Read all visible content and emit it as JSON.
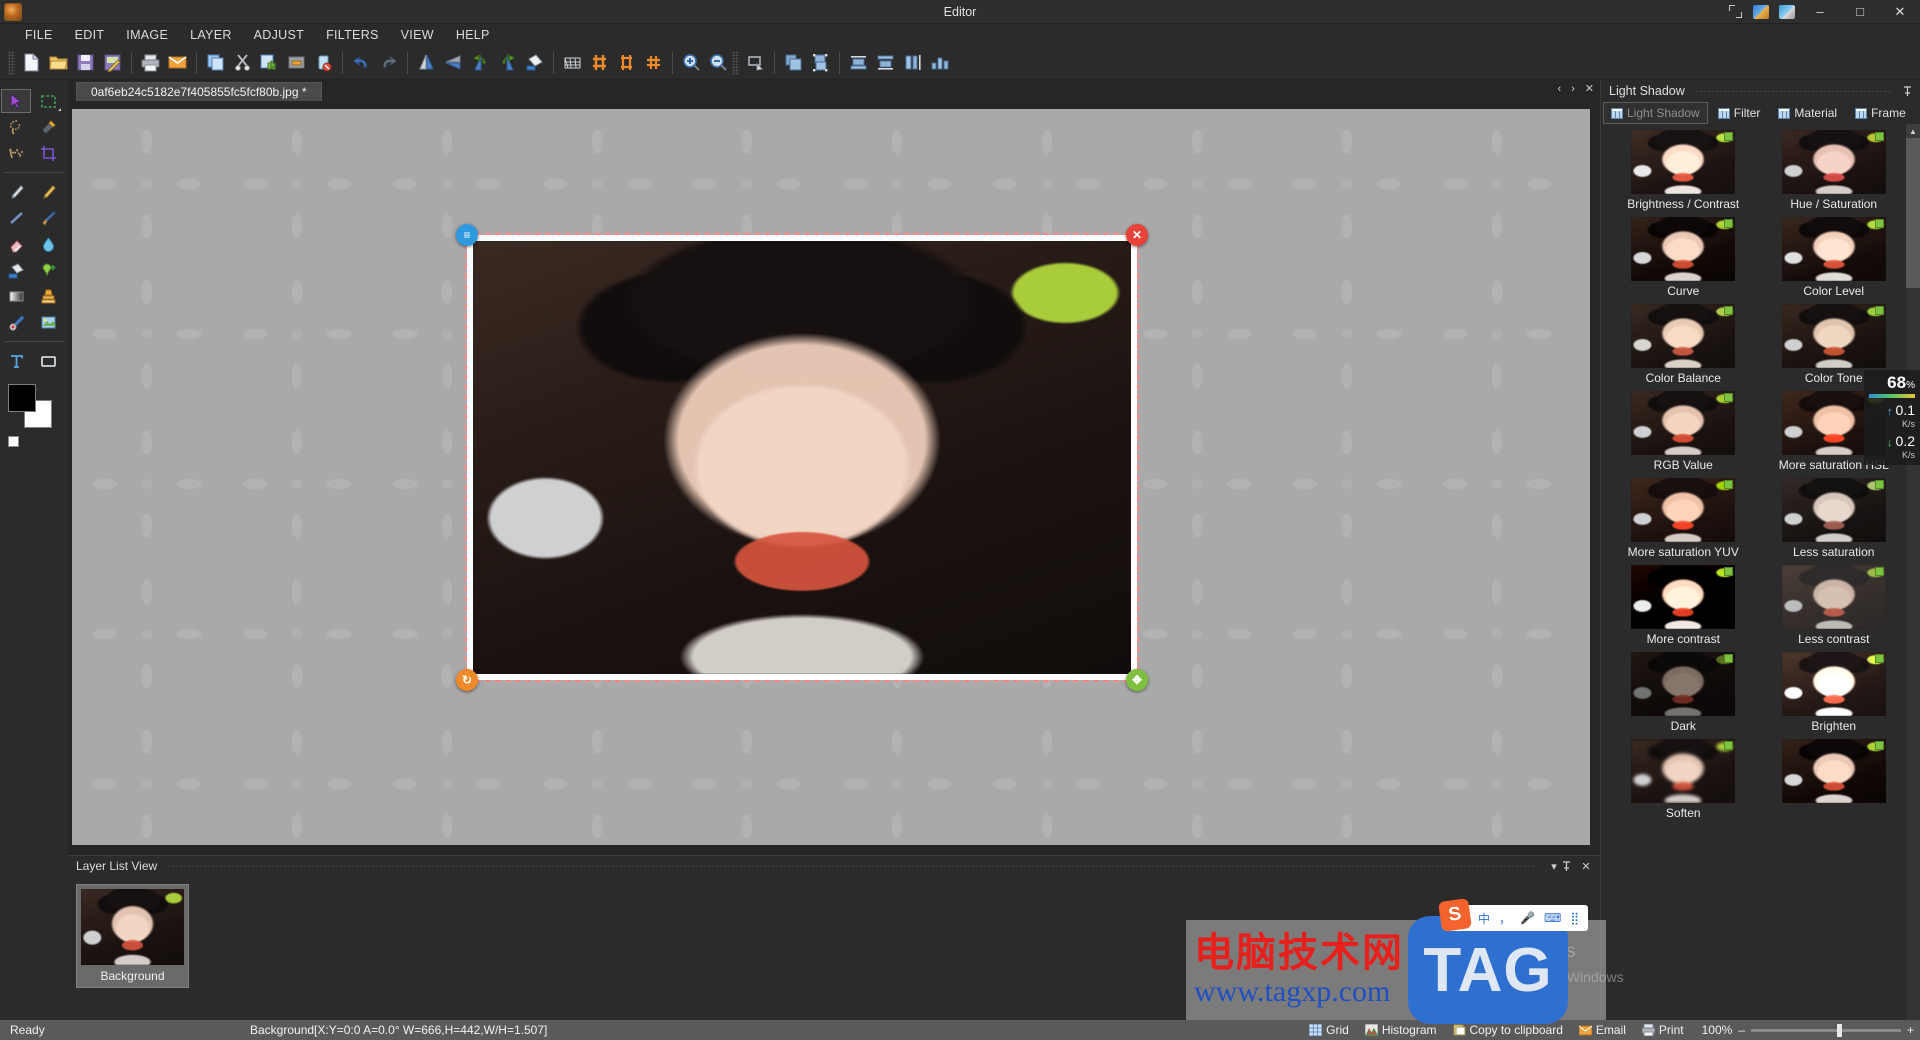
{
  "window": {
    "title": "Editor",
    "app_icon": "app-icon",
    "controls": {
      "minimize": "–",
      "maximize": "□",
      "close": "✕"
    },
    "extra_icons": [
      "fullscreen-icon",
      "image-a-icon",
      "image-b-icon"
    ]
  },
  "menubar": {
    "items": [
      "FILE",
      "EDIT",
      "IMAGE",
      "LAYER",
      "ADJUST",
      "FILTERS",
      "VIEW",
      "HELP"
    ]
  },
  "toolbar": {
    "groups": [
      [
        "new-document",
        "open-folder",
        "save-floppy",
        "save-as"
      ],
      [
        "print",
        "email"
      ],
      [
        "copy",
        "cut",
        "paste",
        "delete-selection",
        "clear-trash"
      ],
      [
        "undo",
        "redo"
      ],
      [
        "flip-horizontal",
        "flip-vertical",
        "rotate-left",
        "rotate-right",
        "fill-bucket"
      ],
      [
        "perspective-grid",
        "warp-mesh",
        "mesh-vertical",
        "mesh-hash"
      ],
      [
        "zoom-in",
        "zoom-out"
      ],
      [
        "select-shape",
        "layer-front",
        "layer-group"
      ],
      [
        "align-top",
        "align-bottom",
        "align-left",
        "align-distribute"
      ]
    ]
  },
  "tools": {
    "items": [
      {
        "name": "pointer-tool",
        "selected": true
      },
      {
        "name": "rect-select-tool",
        "selected": false
      },
      {
        "name": "lasso-tool",
        "selected": false
      },
      {
        "name": "magic-wand-tool",
        "selected": false
      },
      {
        "name": "polygon-lasso-tool",
        "selected": false
      },
      {
        "name": "crop-tool",
        "selected": false
      },
      {
        "name": "pen-tool",
        "selected": false
      },
      {
        "name": "pencil-tool",
        "selected": false
      },
      {
        "name": "line-tool",
        "selected": false
      },
      {
        "name": "brush-tool",
        "selected": false
      },
      {
        "name": "eraser-tool",
        "selected": false
      },
      {
        "name": "blur-drop-tool",
        "selected": false
      },
      {
        "name": "paint-bucket-tool",
        "selected": false
      },
      {
        "name": "color-picker-add-tool",
        "selected": false
      },
      {
        "name": "gradient-tool",
        "selected": false
      },
      {
        "name": "stamp-tool",
        "selected": false
      },
      {
        "name": "red-eye-tool",
        "selected": false
      },
      {
        "name": "image-effect-tool",
        "selected": false
      },
      {
        "name": "text-tool",
        "selected": false
      },
      {
        "name": "shape-rect-tool",
        "selected": false
      }
    ],
    "foreground_color": "#000000",
    "background_color": "#ffffff"
  },
  "document": {
    "tab_label": "0af6eb24c5182e7f405855fc5fcf80b.jpg *",
    "tab_nav": [
      "‹",
      "›",
      "✕"
    ],
    "handles": [
      {
        "name": "menu-handle",
        "glyph": "≡",
        "color": "#2f9ae0"
      },
      {
        "name": "close-handle",
        "glyph": "✕",
        "color": "#e8433a"
      },
      {
        "name": "rotate-handle",
        "glyph": "↻",
        "color": "#ef8a2b"
      },
      {
        "name": "scale-handle",
        "glyph": "✥",
        "color": "#7fbf3f"
      }
    ]
  },
  "layer_panel": {
    "title": "Layer List View",
    "header_buttons": [
      "▾",
      "📌",
      "✕"
    ],
    "layers": [
      {
        "name": "Background"
      }
    ]
  },
  "right_panel": {
    "title": "Light Shadow",
    "pin_icon": "pin-icon",
    "tabs": [
      {
        "label": "Light Shadow",
        "active": true
      },
      {
        "label": "Filter",
        "active": false
      },
      {
        "label": "Material",
        "active": false
      },
      {
        "label": "Frame",
        "active": false
      }
    ],
    "filters": [
      {
        "label": "Brightness / Contrast",
        "variant": "v-bright"
      },
      {
        "label": "Hue / Saturation",
        "variant": "v-hue"
      },
      {
        "label": "Curve",
        "variant": "v-curve"
      },
      {
        "label": "Color Level",
        "variant": "v-level"
      },
      {
        "label": "Color Balance",
        "variant": "v-balance"
      },
      {
        "label": "Color Tone",
        "variant": "v-tone"
      },
      {
        "label": "RGB Value",
        "variant": "v-rgb"
      },
      {
        "label": "More saturation HSL",
        "variant": "v-sat-hsl"
      },
      {
        "label": "More saturation YUV",
        "variant": "v-sat-yuv"
      },
      {
        "label": "Less saturation",
        "variant": "v-less-sat"
      },
      {
        "label": "More contrast",
        "variant": "v-more-con"
      },
      {
        "label": "Less contrast",
        "variant": "v-less-con"
      },
      {
        "label": "Dark",
        "variant": "v-dark"
      },
      {
        "label": "Brighten",
        "variant": "v-brighten"
      },
      {
        "label": "Soften",
        "variant": "v-soften"
      },
      {
        "label": "",
        "variant": "v-curve"
      }
    ]
  },
  "statusbar": {
    "ready": "Ready",
    "info": "Background[X:Y=0:0 A=0.0° W=666,H=442,W/H=1.507]",
    "buttons": [
      {
        "label": "Grid",
        "icon": "grid-icon"
      },
      {
        "label": "Histogram",
        "icon": "histogram-icon"
      },
      {
        "label": "Copy to clipboard",
        "icon": "clipboard-icon"
      },
      {
        "label": "Email",
        "icon": "email-icon"
      },
      {
        "label": "Print",
        "icon": "print-icon"
      }
    ],
    "zoom": {
      "value": "100%",
      "minus": "–",
      "plus": "+"
    }
  },
  "overlays": {
    "network_monitor": {
      "cpu": "68",
      "cpu_unit": "%",
      "upload": "0.1",
      "upload_unit": "K/s",
      "download": "0.2",
      "download_unit": "K/s"
    },
    "watermark": {
      "cn_text": "电脑技术网",
      "url": "www.tagxp.com",
      "logo": "TAG"
    },
    "ime": {
      "logo": "S",
      "items": [
        "中",
        "，",
        "🎤",
        "⌨",
        "⣿"
      ]
    },
    "windows_activation": {
      "line1": "激活 Windows",
      "line2": "转到\"设置\"以激活 Windows"
    }
  }
}
